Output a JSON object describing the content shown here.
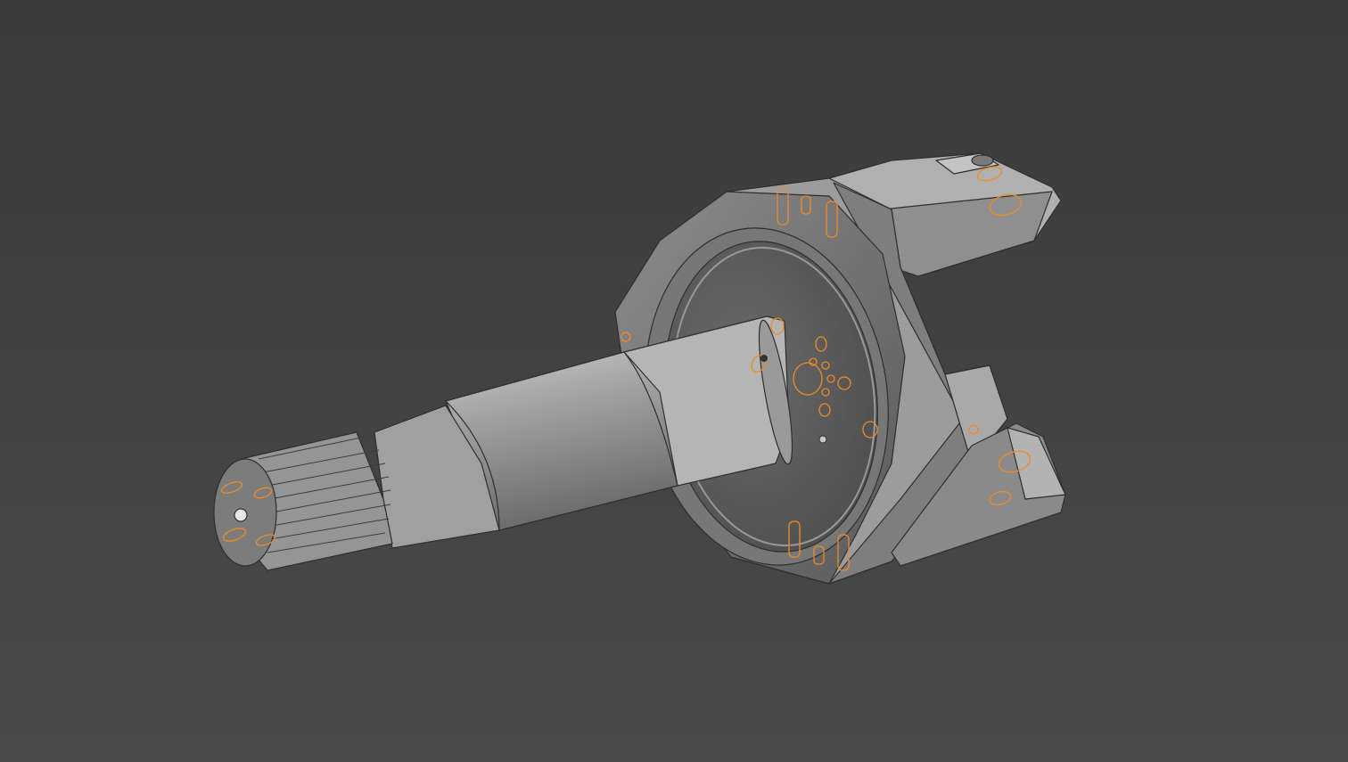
{
  "viewport": {
    "background_top": "#3a3a3a",
    "background_bottom": "#4a4a4a",
    "model_color": "#a8a8a8",
    "edge_color": "#2e2e2e",
    "selection_color": "#f08a24"
  },
  "model": {
    "parts": [
      "spline-shaft-end",
      "drive-shaft",
      "mounting-flange",
      "housing-bracket"
    ],
    "highlighted_features": "hole-edges"
  }
}
